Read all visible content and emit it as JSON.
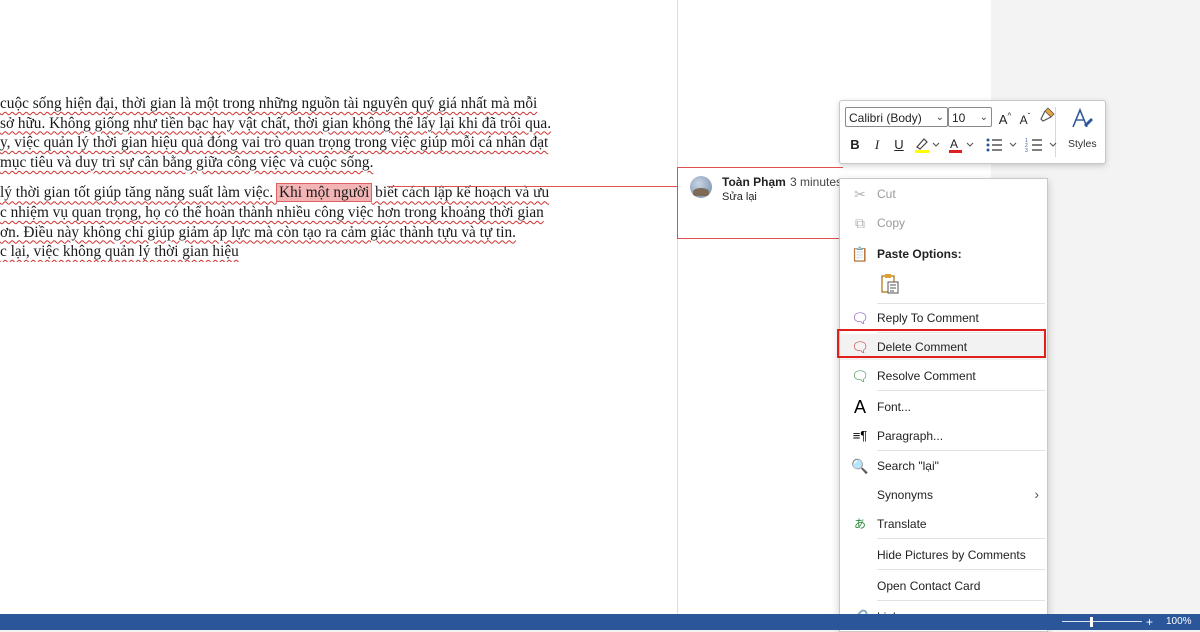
{
  "document": {
    "paragraphs": [
      [
        "cuộc sống hiện đại, thời gian là một trong những nguồn tài nguyên quý giá nhất mà mỗi",
        "sở hữu. Không giống như tiền bạc hay vật chất, thời gian không thể lấy lại khi đã trôi qua.",
        "y, việc quản lý thời gian hiệu quả đóng vai trò quan trọng trong việc giúp mỗi cá nhân đạt",
        "mục tiêu và duy trì sự cân bằng giữa công việc và cuộc sống."
      ]
    ],
    "p2_line1_before": "lý thời gian tốt giúp tăng năng suất làm việc. ",
    "p2_line1_highlight": "Khi một người",
    "p2_line1_after": " biết cách lập kế hoạch và ưu",
    "p2_lines": [
      "c nhiệm vụ quan trọng, họ có thể hoàn thành nhiều công việc hơn trong khoảng thời gian",
      "ơn. Điều này không chỉ giúp giảm áp lực mà còn tạo ra cảm giác thành tựu và tự tin.",
      "c lại, việc không quản lý thời gian hiệu"
    ]
  },
  "comment": {
    "author": "Toàn Phạm",
    "time": "3 minutes",
    "text": "Sửa lại"
  },
  "mini_toolbar": {
    "font_name": "Calibri (Body)",
    "font_size": "10",
    "grow_font": "A^",
    "shrink_font": "Aˇ",
    "bold": "B",
    "italic": "I",
    "underline": "U",
    "styles_label": "Styles",
    "highlight_color": "#ffff00",
    "font_color": "#e02020"
  },
  "context_menu": {
    "cut": "Cut",
    "copy": "Copy",
    "paste_options": "Paste Options:",
    "reply": "Reply To Comment",
    "delete": "Delete Comment",
    "resolve": "Resolve Comment",
    "font": "Font...",
    "paragraph": "Paragraph...",
    "search": "Search \"lại\"",
    "synonyms": "Synonyms",
    "translate": "Translate",
    "hide_pictures": "Hide Pictures by Comments",
    "open_contact": "Open Contact Card",
    "link": "Link"
  },
  "status_bar": {
    "zoom": "100%",
    "zoom_in": "+",
    "color": "#2b579a"
  }
}
